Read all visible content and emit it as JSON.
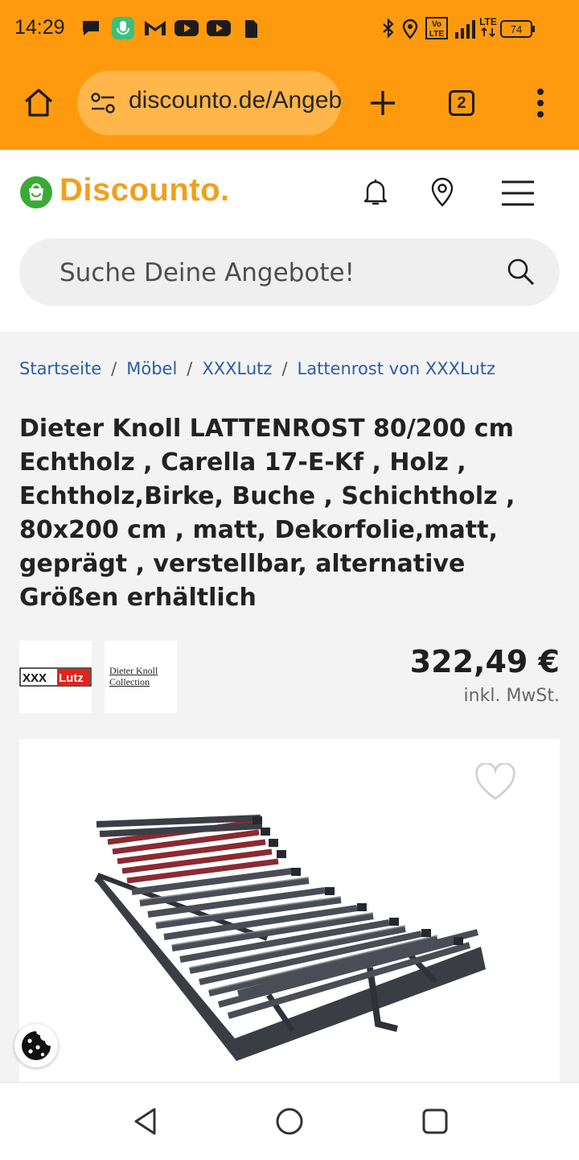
{
  "status_bar": {
    "time": "14:29",
    "battery": "74",
    "network": "LTE",
    "volte": "Vo LTE"
  },
  "browser": {
    "url": "discounto.de/Angebote",
    "tab_count": "2"
  },
  "site": {
    "logo_text": "Discounto."
  },
  "search": {
    "placeholder": "Suche Deine Angebote!"
  },
  "breadcrumb": {
    "items": [
      "Startseite",
      "Möbel",
      "XXXLutz",
      "Lattenrost von XXXLutz"
    ]
  },
  "product": {
    "title": "Dieter Knoll LATTENROST 80/200 cm Echtholz , Carella 17-E-Kf , Holz , Echtholz,Birke, Buche , Schichtholz , 80x200 cm , matt, Dekorfolie,matt, geprägt , verstellbar, alternative Größen erhältlich",
    "price": "322,49 €",
    "vat_note": "inkl. MwSt.",
    "retailer_logo_text": "XXXLutz",
    "brand_logo_line1": "Dieter Knoll",
    "brand_logo_line2": "Collection"
  },
  "colors": {
    "browser_bar": "#ff9a0e",
    "brand_orange": "#f0a01c",
    "brand_green": "#3aaa35",
    "link": "#2b5da6"
  },
  "icons": [
    "home-icon",
    "site-settings-icon",
    "new-tab-icon",
    "tab-switcher-icon",
    "overflow-menu-icon",
    "bell-icon",
    "location-pin-icon",
    "hamburger-menu-icon",
    "search-icon",
    "heart-icon",
    "cookie-icon",
    "back-icon",
    "home-circle-icon",
    "recents-icon"
  ]
}
